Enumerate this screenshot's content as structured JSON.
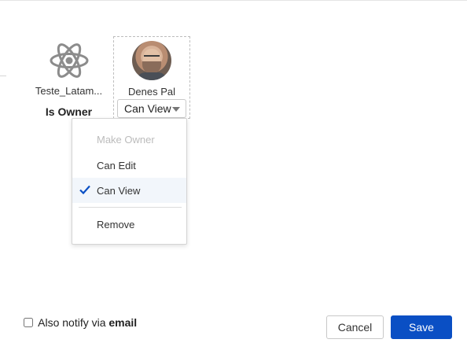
{
  "members": [
    {
      "name": "Teste_Latam...",
      "role": "Is Owner",
      "icon": "atom-icon"
    },
    {
      "name": "Denes Pal",
      "permission": "Can View",
      "icon": "avatar"
    }
  ],
  "permission_menu": {
    "items": [
      {
        "label": "Make Owner",
        "state": "disabled"
      },
      {
        "label": "Can Edit",
        "state": "normal"
      },
      {
        "label": "Can View",
        "state": "selected"
      },
      {
        "label": "Remove",
        "state": "normal"
      }
    ]
  },
  "footer": {
    "notify_prefix": "Also notify via",
    "notify_emphasis": "email",
    "notify_checked": false,
    "cancel_label": "Cancel",
    "save_label": "Save"
  },
  "colors": {
    "accent": "#0a4fc4",
    "menu_active_bg": "#f2f6fb",
    "disabled_text": "#bcbcbc"
  }
}
